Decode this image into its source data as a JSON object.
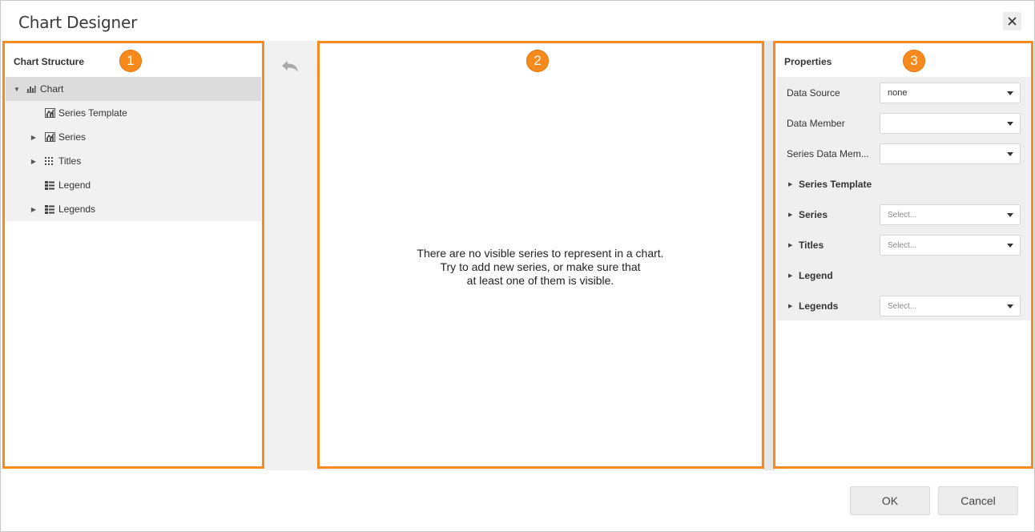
{
  "dialog": {
    "title": "Chart Designer"
  },
  "callouts": [
    "1",
    "2",
    "3"
  ],
  "structure": {
    "header": "Chart Structure",
    "items": [
      {
        "label": "Chart",
        "icon": "chart-icon",
        "expander": "expanded"
      },
      {
        "label": "Series Template",
        "icon": "series-icon",
        "expander": "none"
      },
      {
        "label": "Series",
        "icon": "series-icon",
        "expander": "collapsed"
      },
      {
        "label": "Titles",
        "icon": "titles-icon",
        "expander": "collapsed"
      },
      {
        "label": "Legend",
        "icon": "legend-icon",
        "expander": "none"
      },
      {
        "label": "Legends",
        "icon": "legend-icon",
        "expander": "collapsed"
      }
    ]
  },
  "preview": {
    "message_line1": "There are no visible series to represent in a chart.",
    "message_line2": "Try to add new series, or make sure that",
    "message_line3": "at least one of them is visible."
  },
  "properties": {
    "header": "Properties",
    "data_source": {
      "label": "Data Source",
      "value": "none"
    },
    "data_member": {
      "label": "Data Member",
      "value": ""
    },
    "series_data_member": {
      "label": "Series Data Mem...",
      "value": ""
    },
    "series_template": {
      "label": "Series Template"
    },
    "series": {
      "label": "Series",
      "placeholder": "Select..."
    },
    "titles": {
      "label": "Titles",
      "placeholder": "Select..."
    },
    "legend": {
      "label": "Legend"
    },
    "legends": {
      "label": "Legends",
      "placeholder": "Select..."
    }
  },
  "footer": {
    "ok_label": "OK",
    "cancel_label": "Cancel"
  },
  "colors": {
    "accent": "#f7891d",
    "selected_row": "#dcdcdc",
    "panel_bg": "#f1f1f1"
  }
}
